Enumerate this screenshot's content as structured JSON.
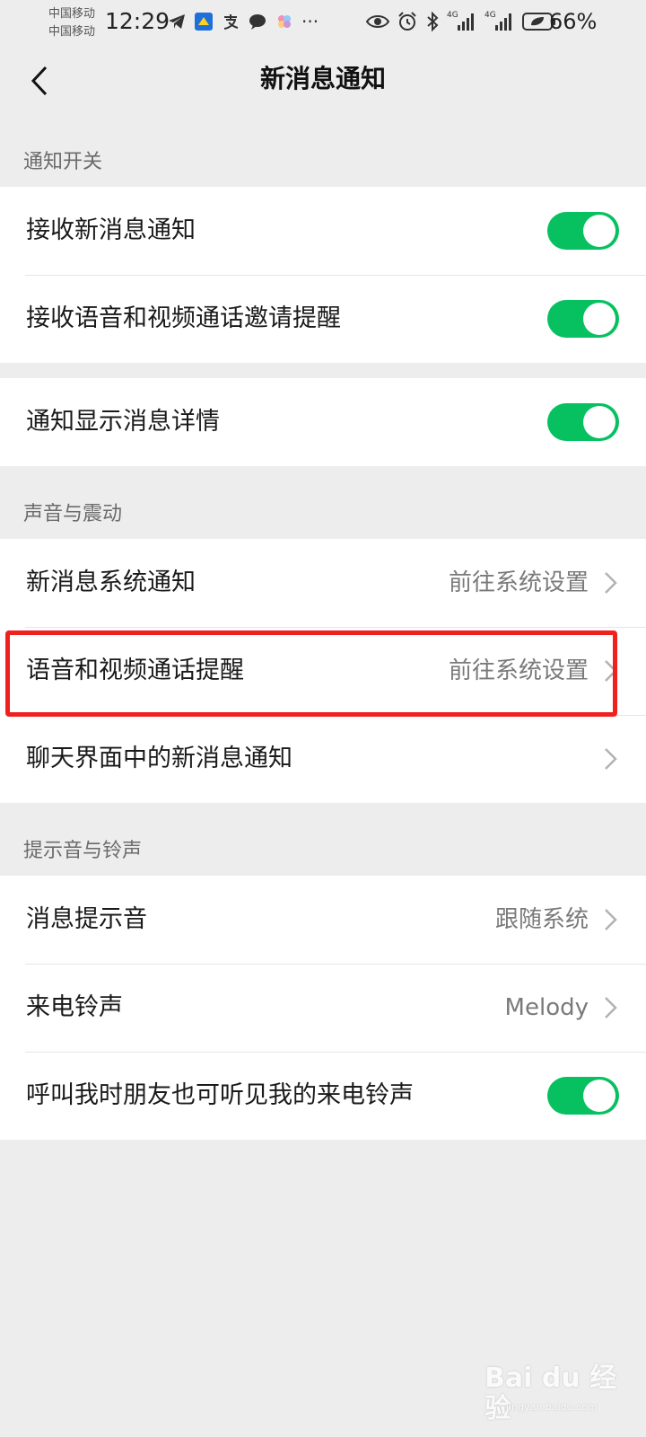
{
  "status_bar": {
    "carrier_1": "中国移动",
    "carrier_2": "中国移动",
    "time": "12:29",
    "more": "···",
    "battery": "66%",
    "network_1": "4G",
    "network_2": "4G",
    "icons": [
      "telegram-icon",
      "app-icon",
      "alipay-icon",
      "chat-bubble-icon",
      "flower-app-icon",
      "eye-icon",
      "alarm-icon",
      "bluetooth-icon",
      "signal-icon",
      "signal-icon",
      "battery-icon"
    ]
  },
  "nav": {
    "title": "新消息通知",
    "back_icon": "chevron-left-icon"
  },
  "sections": {
    "notify_switch": {
      "label": "通知开关",
      "items": [
        {
          "label": "接收新消息通知",
          "toggle": true
        },
        {
          "label": "接收语音和视频通话邀请提醒",
          "toggle": true
        }
      ]
    },
    "detail": {
      "items": [
        {
          "label": "通知显示消息详情",
          "toggle": true
        }
      ]
    },
    "sound_vibrate": {
      "label": "声音与震动",
      "items": [
        {
          "label": "新消息系统通知",
          "value": "前往系统设置"
        },
        {
          "label": "语音和视频通话提醒",
          "value": "前往系统设置"
        },
        {
          "label": "聊天界面中的新消息通知",
          "value": ""
        }
      ]
    },
    "tones": {
      "label": "提示音与铃声",
      "items": [
        {
          "label": "消息提示音",
          "value": "跟随系统"
        },
        {
          "label": "来电铃声",
          "value": "Melody"
        },
        {
          "label": "呼叫我时朋友也可听见我的来电铃声",
          "toggle": true
        }
      ]
    }
  },
  "colors": {
    "toggle_on": "#07c160",
    "highlight": "#f0201e",
    "background": "#ededed"
  },
  "watermark": {
    "logo": "Bai du 经验",
    "url": "jingyan.baidu.com"
  }
}
